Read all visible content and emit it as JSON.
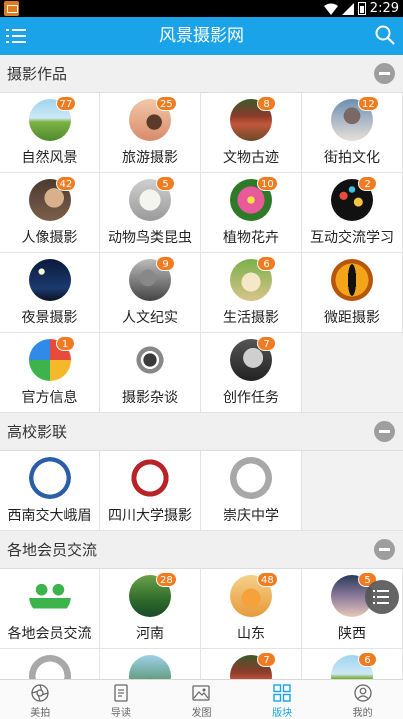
{
  "status_bar": {
    "time": "2:29"
  },
  "header": {
    "title": "风景摄影网"
  },
  "sections": [
    {
      "title": "摄影作品",
      "items": [
        {
          "name": "自然风景",
          "badge": "77",
          "thumb": "landscape"
        },
        {
          "name": "旅游摄影",
          "badge": "25",
          "thumb": "horse"
        },
        {
          "name": "文物古迹",
          "badge": "8",
          "thumb": "temple"
        },
        {
          "name": "街拍文化",
          "badge": "12",
          "thumb": "street"
        },
        {
          "name": "人像摄影",
          "badge": "42",
          "thumb": "portrait"
        },
        {
          "name": "动物鸟类昆虫",
          "badge": "5",
          "thumb": "dog"
        },
        {
          "name": "植物花卉",
          "badge": "10",
          "thumb": "flower"
        },
        {
          "name": "互动交流学习",
          "badge": "2",
          "thumb": "bokeh"
        },
        {
          "name": "夜景摄影",
          "badge": "",
          "thumb": "night"
        },
        {
          "name": "人文纪实",
          "badge": "9",
          "thumb": "documentary"
        },
        {
          "name": "生活摄影",
          "badge": "6",
          "thumb": "life"
        },
        {
          "name": "微距摄影",
          "badge": "",
          "thumb": "macro"
        },
        {
          "name": "官方信息",
          "badge": "1",
          "thumb": "official"
        },
        {
          "name": "摄影杂谈",
          "badge": "",
          "thumb": "camera"
        },
        {
          "name": "创作任务",
          "badge": "7",
          "thumb": "creation"
        }
      ]
    },
    {
      "title": "高校影联",
      "items": [
        {
          "name": "西南交大峨眉",
          "badge": "",
          "thumb": "swjtu"
        },
        {
          "name": "四川大学摄影",
          "badge": "",
          "thumb": "scu"
        },
        {
          "name": "崇庆中学",
          "badge": "",
          "thumb": "chat"
        }
      ]
    },
    {
      "title": "各地会员交流",
      "items": [
        {
          "name": "各地会员交流",
          "badge": "",
          "thumb": "members"
        },
        {
          "name": "河南",
          "badge": "28",
          "thumb": "henan"
        },
        {
          "name": "山东",
          "badge": "48",
          "thumb": "shandong"
        },
        {
          "name": "陕西",
          "badge": "5",
          "thumb": "shaanxi"
        },
        {
          "name": "",
          "badge": "",
          "thumb": "chat"
        },
        {
          "name": "",
          "badge": "",
          "thumb": "tree"
        },
        {
          "name": "",
          "badge": "7",
          "thumb": "temple"
        },
        {
          "name": "",
          "badge": "6",
          "thumb": "landscape"
        }
      ]
    }
  ],
  "bottom_nav": [
    {
      "label": "美拍",
      "icon": "aperture-icon",
      "active": false
    },
    {
      "label": "导读",
      "icon": "document-icon",
      "active": false
    },
    {
      "label": "发图",
      "icon": "image-icon",
      "active": false
    },
    {
      "label": "版块",
      "icon": "grid-icon",
      "active": true
    },
    {
      "label": "我的",
      "icon": "user-icon",
      "active": false
    }
  ],
  "colors": {
    "header": "#1aa3e8",
    "badge": "#f07c22",
    "active_tab": "#1aa3e8"
  }
}
